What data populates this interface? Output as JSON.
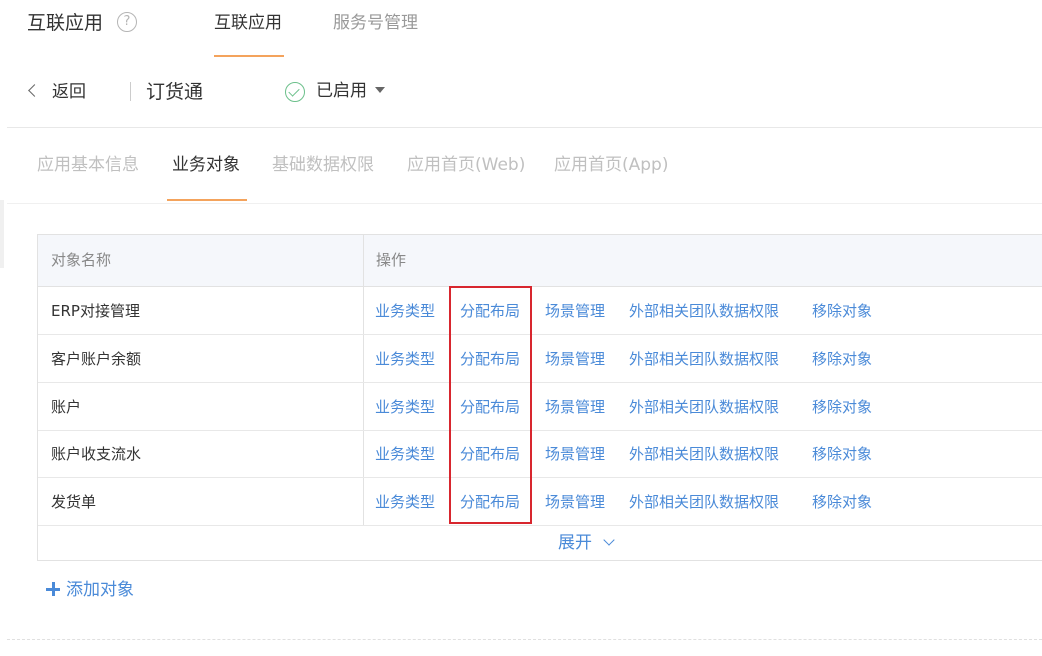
{
  "header": {
    "title": "互联应用",
    "tabs": [
      {
        "label": "互联应用",
        "active": true
      },
      {
        "label": "服务号管理",
        "active": false
      }
    ]
  },
  "subheader": {
    "back_label": "返回",
    "app_name": "订货通",
    "status_label": "已启用"
  },
  "sub_tabs": [
    {
      "label": "应用基本信息",
      "active": false
    },
    {
      "label": "业务对象",
      "active": true
    },
    {
      "label": "基础数据权限",
      "active": false
    },
    {
      "label": "应用首页(Web)",
      "active": false
    },
    {
      "label": "应用首页(App)",
      "active": false
    }
  ],
  "table": {
    "columns": [
      "对象名称",
      "操作"
    ],
    "operations": [
      "业务类型",
      "分配布局",
      "场景管理",
      "外部相关团队数据权限",
      "移除对象"
    ],
    "rows": [
      {
        "name": "ERP对接管理"
      },
      {
        "name": "客户账户余额"
      },
      {
        "name": "账户"
      },
      {
        "name": "账户收支流水"
      },
      {
        "name": "发货单"
      }
    ],
    "expand_label": "展开"
  },
  "add_object_label": "添加对象",
  "colors": {
    "accent": "#f4a35c",
    "link": "#4a8ad8",
    "highlight": "#d8262e",
    "status_ok": "#6cc08b"
  }
}
